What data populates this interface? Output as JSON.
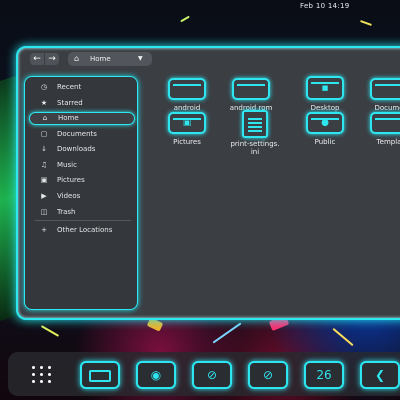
{
  "topbar": {
    "clock": "Feb 10  14:19"
  },
  "headerbar": {
    "back_icon": "arrow-left-icon",
    "forward_icon": "arrow-right-icon",
    "path_label": "Home",
    "path_icon": "home-icon",
    "dropdown_icon": "chevron-down-icon"
  },
  "sidebar": {
    "items": [
      {
        "label": "Recent",
        "icon": "clock-icon"
      },
      {
        "label": "Starred",
        "icon": "star-icon"
      },
      {
        "label": "Home",
        "icon": "home-icon",
        "active": true
      },
      {
        "label": "Documents",
        "icon": "document-icon"
      },
      {
        "label": "Downloads",
        "icon": "download-icon"
      },
      {
        "label": "Music",
        "icon": "music-icon"
      },
      {
        "label": "Pictures",
        "icon": "camera-icon"
      },
      {
        "label": "Videos",
        "icon": "video-icon"
      },
      {
        "label": "Trash",
        "icon": "trash-icon"
      },
      {
        "label": "Other Locations",
        "icon": "plus-icon"
      }
    ]
  },
  "files": [
    {
      "name": "android",
      "type": "folder"
    },
    {
      "name": "android rom",
      "type": "folder"
    },
    {
      "name": "Desktop",
      "type": "folder"
    },
    {
      "name": "Docume",
      "type": "folder"
    },
    {
      "name": "Pictures",
      "type": "folder"
    },
    {
      "name": "print-settings.\nini",
      "type": "file"
    },
    {
      "name": "Public",
      "type": "folder"
    },
    {
      "name": "Templa",
      "type": "folder"
    }
  ],
  "dock": {
    "apps": [
      {
        "name": "show-apps-icon"
      },
      {
        "name": "files-icon"
      },
      {
        "name": "chrome-icon"
      },
      {
        "name": "safari-icon"
      },
      {
        "name": "safari-icon"
      },
      {
        "name": "calendar-icon",
        "label": "26"
      },
      {
        "name": "vscode-icon"
      }
    ]
  },
  "colors": {
    "accent": "#2de6f0",
    "window_bg": "#3b3e43"
  }
}
